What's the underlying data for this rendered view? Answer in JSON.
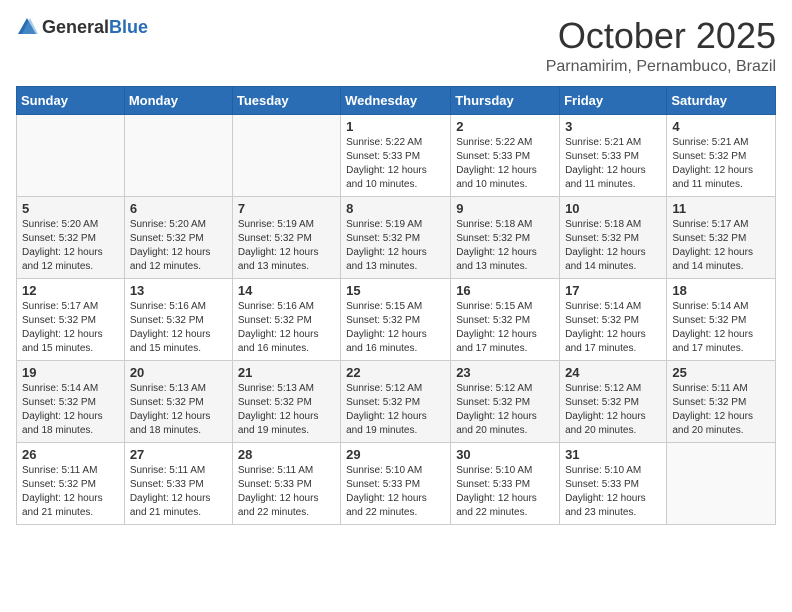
{
  "header": {
    "logo_general": "General",
    "logo_blue": "Blue",
    "month": "October 2025",
    "location": "Parnamirim, Pernambuco, Brazil"
  },
  "weekdays": [
    "Sunday",
    "Monday",
    "Tuesday",
    "Wednesday",
    "Thursday",
    "Friday",
    "Saturday"
  ],
  "weeks": [
    [
      {
        "day": "",
        "sunrise": "",
        "sunset": "",
        "daylight": ""
      },
      {
        "day": "",
        "sunrise": "",
        "sunset": "",
        "daylight": ""
      },
      {
        "day": "",
        "sunrise": "",
        "sunset": "",
        "daylight": ""
      },
      {
        "day": "1",
        "sunrise": "Sunrise: 5:22 AM",
        "sunset": "Sunset: 5:33 PM",
        "daylight": "Daylight: 12 hours and 10 minutes."
      },
      {
        "day": "2",
        "sunrise": "Sunrise: 5:22 AM",
        "sunset": "Sunset: 5:33 PM",
        "daylight": "Daylight: 12 hours and 10 minutes."
      },
      {
        "day": "3",
        "sunrise": "Sunrise: 5:21 AM",
        "sunset": "Sunset: 5:33 PM",
        "daylight": "Daylight: 12 hours and 11 minutes."
      },
      {
        "day": "4",
        "sunrise": "Sunrise: 5:21 AM",
        "sunset": "Sunset: 5:32 PM",
        "daylight": "Daylight: 12 hours and 11 minutes."
      }
    ],
    [
      {
        "day": "5",
        "sunrise": "Sunrise: 5:20 AM",
        "sunset": "Sunset: 5:32 PM",
        "daylight": "Daylight: 12 hours and 12 minutes."
      },
      {
        "day": "6",
        "sunrise": "Sunrise: 5:20 AM",
        "sunset": "Sunset: 5:32 PM",
        "daylight": "Daylight: 12 hours and 12 minutes."
      },
      {
        "day": "7",
        "sunrise": "Sunrise: 5:19 AM",
        "sunset": "Sunset: 5:32 PM",
        "daylight": "Daylight: 12 hours and 13 minutes."
      },
      {
        "day": "8",
        "sunrise": "Sunrise: 5:19 AM",
        "sunset": "Sunset: 5:32 PM",
        "daylight": "Daylight: 12 hours and 13 minutes."
      },
      {
        "day": "9",
        "sunrise": "Sunrise: 5:18 AM",
        "sunset": "Sunset: 5:32 PM",
        "daylight": "Daylight: 12 hours and 13 minutes."
      },
      {
        "day": "10",
        "sunrise": "Sunrise: 5:18 AM",
        "sunset": "Sunset: 5:32 PM",
        "daylight": "Daylight: 12 hours and 14 minutes."
      },
      {
        "day": "11",
        "sunrise": "Sunrise: 5:17 AM",
        "sunset": "Sunset: 5:32 PM",
        "daylight": "Daylight: 12 hours and 14 minutes."
      }
    ],
    [
      {
        "day": "12",
        "sunrise": "Sunrise: 5:17 AM",
        "sunset": "Sunset: 5:32 PM",
        "daylight": "Daylight: 12 hours and 15 minutes."
      },
      {
        "day": "13",
        "sunrise": "Sunrise: 5:16 AM",
        "sunset": "Sunset: 5:32 PM",
        "daylight": "Daylight: 12 hours and 15 minutes."
      },
      {
        "day": "14",
        "sunrise": "Sunrise: 5:16 AM",
        "sunset": "Sunset: 5:32 PM",
        "daylight": "Daylight: 12 hours and 16 minutes."
      },
      {
        "day": "15",
        "sunrise": "Sunrise: 5:15 AM",
        "sunset": "Sunset: 5:32 PM",
        "daylight": "Daylight: 12 hours and 16 minutes."
      },
      {
        "day": "16",
        "sunrise": "Sunrise: 5:15 AM",
        "sunset": "Sunset: 5:32 PM",
        "daylight": "Daylight: 12 hours and 17 minutes."
      },
      {
        "day": "17",
        "sunrise": "Sunrise: 5:14 AM",
        "sunset": "Sunset: 5:32 PM",
        "daylight": "Daylight: 12 hours and 17 minutes."
      },
      {
        "day": "18",
        "sunrise": "Sunrise: 5:14 AM",
        "sunset": "Sunset: 5:32 PM",
        "daylight": "Daylight: 12 hours and 17 minutes."
      }
    ],
    [
      {
        "day": "19",
        "sunrise": "Sunrise: 5:14 AM",
        "sunset": "Sunset: 5:32 PM",
        "daylight": "Daylight: 12 hours and 18 minutes."
      },
      {
        "day": "20",
        "sunrise": "Sunrise: 5:13 AM",
        "sunset": "Sunset: 5:32 PM",
        "daylight": "Daylight: 12 hours and 18 minutes."
      },
      {
        "day": "21",
        "sunrise": "Sunrise: 5:13 AM",
        "sunset": "Sunset: 5:32 PM",
        "daylight": "Daylight: 12 hours and 19 minutes."
      },
      {
        "day": "22",
        "sunrise": "Sunrise: 5:12 AM",
        "sunset": "Sunset: 5:32 PM",
        "daylight": "Daylight: 12 hours and 19 minutes."
      },
      {
        "day": "23",
        "sunrise": "Sunrise: 5:12 AM",
        "sunset": "Sunset: 5:32 PM",
        "daylight": "Daylight: 12 hours and 20 minutes."
      },
      {
        "day": "24",
        "sunrise": "Sunrise: 5:12 AM",
        "sunset": "Sunset: 5:32 PM",
        "daylight": "Daylight: 12 hours and 20 minutes."
      },
      {
        "day": "25",
        "sunrise": "Sunrise: 5:11 AM",
        "sunset": "Sunset: 5:32 PM",
        "daylight": "Daylight: 12 hours and 20 minutes."
      }
    ],
    [
      {
        "day": "26",
        "sunrise": "Sunrise: 5:11 AM",
        "sunset": "Sunset: 5:32 PM",
        "daylight": "Daylight: 12 hours and 21 minutes."
      },
      {
        "day": "27",
        "sunrise": "Sunrise: 5:11 AM",
        "sunset": "Sunset: 5:33 PM",
        "daylight": "Daylight: 12 hours and 21 minutes."
      },
      {
        "day": "28",
        "sunrise": "Sunrise: 5:11 AM",
        "sunset": "Sunset: 5:33 PM",
        "daylight": "Daylight: 12 hours and 22 minutes."
      },
      {
        "day": "29",
        "sunrise": "Sunrise: 5:10 AM",
        "sunset": "Sunset: 5:33 PM",
        "daylight": "Daylight: 12 hours and 22 minutes."
      },
      {
        "day": "30",
        "sunrise": "Sunrise: 5:10 AM",
        "sunset": "Sunset: 5:33 PM",
        "daylight": "Daylight: 12 hours and 22 minutes."
      },
      {
        "day": "31",
        "sunrise": "Sunrise: 5:10 AM",
        "sunset": "Sunset: 5:33 PM",
        "daylight": "Daylight: 12 hours and 23 minutes."
      },
      {
        "day": "",
        "sunrise": "",
        "sunset": "",
        "daylight": ""
      }
    ]
  ]
}
